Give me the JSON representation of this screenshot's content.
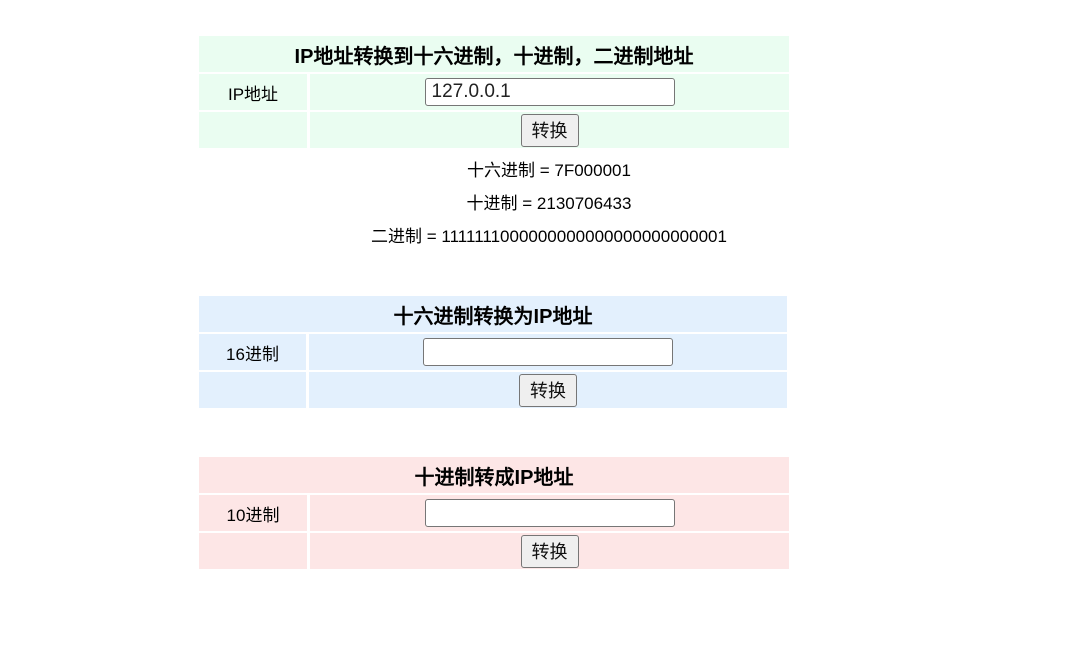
{
  "ip_to_number": {
    "title": "IP地址转换到十六进制，十进制，二进制地址",
    "label": "IP地址",
    "input_value": "127.0.0.1",
    "button_label": "转换",
    "results": {
      "hex_label": "十六进制",
      "hex_value": "7F000001",
      "dec_label": "十进制",
      "dec_value": "2130706433",
      "bin_label": "二进制",
      "bin_value": "1111111000000000000000000000001"
    }
  },
  "hex_to_ip": {
    "title": "十六进制转换为IP地址",
    "label": "16进制",
    "input_value": "",
    "button_label": "转换"
  },
  "dec_to_ip": {
    "title": "十进制转成IP地址",
    "label": "10进制",
    "input_value": "",
    "button_label": "转换"
  },
  "colors": {
    "green_panel": "#eafdf1",
    "blue_panel": "#e3f0fd",
    "red_panel": "#fde6e6"
  }
}
